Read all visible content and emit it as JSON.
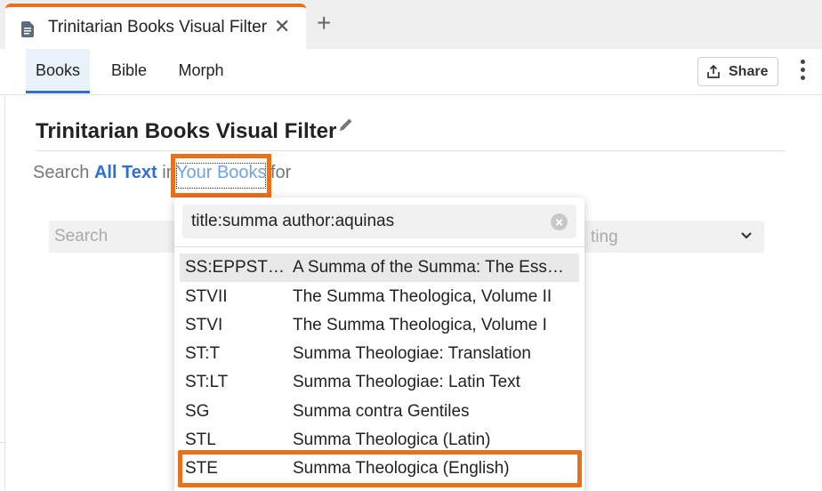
{
  "tab": {
    "title": "Trinitarian Books Visual Filter",
    "close_icon": "close-icon",
    "new_tab_icon": "plus-icon"
  },
  "toolbar": {
    "tabs": [
      {
        "label": "Books",
        "active": true
      },
      {
        "label": "Bible",
        "active": false
      },
      {
        "label": "Morph",
        "active": false
      }
    ],
    "share_label": "Share"
  },
  "page": {
    "title": "Trinitarian Books Visual Filter",
    "search_prefix": "Search",
    "scope": "All Text",
    "in_word": "in",
    "collection": "Your Books",
    "for_word": "for"
  },
  "background": {
    "search_placeholder": "Search",
    "select_partial": "ting"
  },
  "dropdown": {
    "query": "title:summa author:aquinas",
    "results": [
      {
        "code": "SS:EPPST…",
        "name": "A Summa of the Summa: The Ess…"
      },
      {
        "code": "STVII",
        "name": "The Summa Theologica, Volume II"
      },
      {
        "code": "STVI",
        "name": "The Summa Theologica, Volume I"
      },
      {
        "code": "ST:T",
        "name": "Summa Theologiae: Translation"
      },
      {
        "code": "ST:LT",
        "name": "Summa Theologiae: Latin Text"
      },
      {
        "code": "SG",
        "name": "Summa contra Gentiles"
      },
      {
        "code": "STL",
        "name": "Summa Theologica (Latin)"
      },
      {
        "code": "STE",
        "name": "Summa Theologica (English)"
      }
    ]
  },
  "colors": {
    "accent": "#e8711e",
    "link": "#2f6fcf"
  }
}
